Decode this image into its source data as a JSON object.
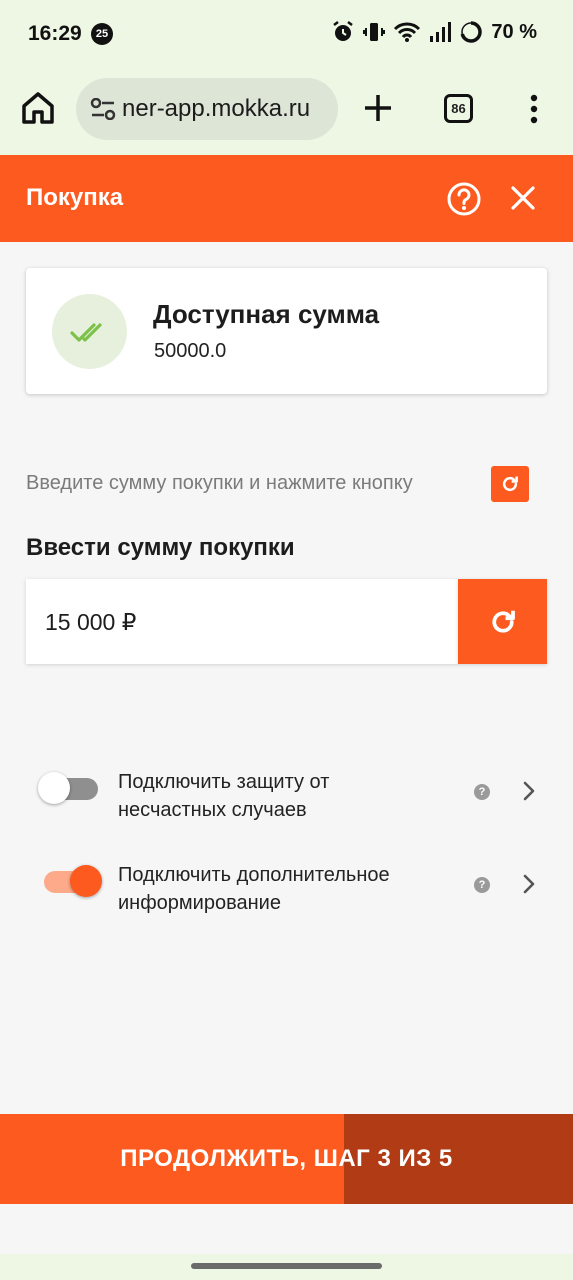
{
  "status_bar": {
    "time": "16:29",
    "notification_badge": "25",
    "battery_text": "70 %",
    "icons": [
      "alarm-icon",
      "vibrate-icon",
      "wifi-icon",
      "signal-icon",
      "battery-icon"
    ]
  },
  "browser": {
    "url": "ner-app.mokka.ru",
    "tab_count": "86",
    "icons": [
      "home-icon",
      "site-settings-icon",
      "new-tab-icon",
      "tabs-icon",
      "more-vert-icon"
    ]
  },
  "header": {
    "title": "Покупка",
    "icons": [
      "help-icon",
      "close-icon"
    ]
  },
  "limit_card": {
    "title": "Доступная сумма",
    "value": "50000.0",
    "icon": "double-check-icon"
  },
  "hint": {
    "text": "Введите сумму покупки и нажмите кнопку"
  },
  "amount": {
    "section_title": "Ввести сумму покупки",
    "value": "15 000 ₽"
  },
  "options": [
    {
      "label": "Подключить защиту от несчастных случаев",
      "enabled": false
    },
    {
      "label": "Подключить дополнительное информирование",
      "enabled": true
    }
  ],
  "continue_button": {
    "label": "ПРОДОЛЖИТЬ, ШАГ 3 ИЗ 5",
    "step": 3,
    "total_steps": 5
  },
  "colors": {
    "accent": "#fc5a1e",
    "accent_dark": "#b03b14",
    "chrome_bg": "#eef7e4",
    "check_green": "#7cc24a"
  }
}
